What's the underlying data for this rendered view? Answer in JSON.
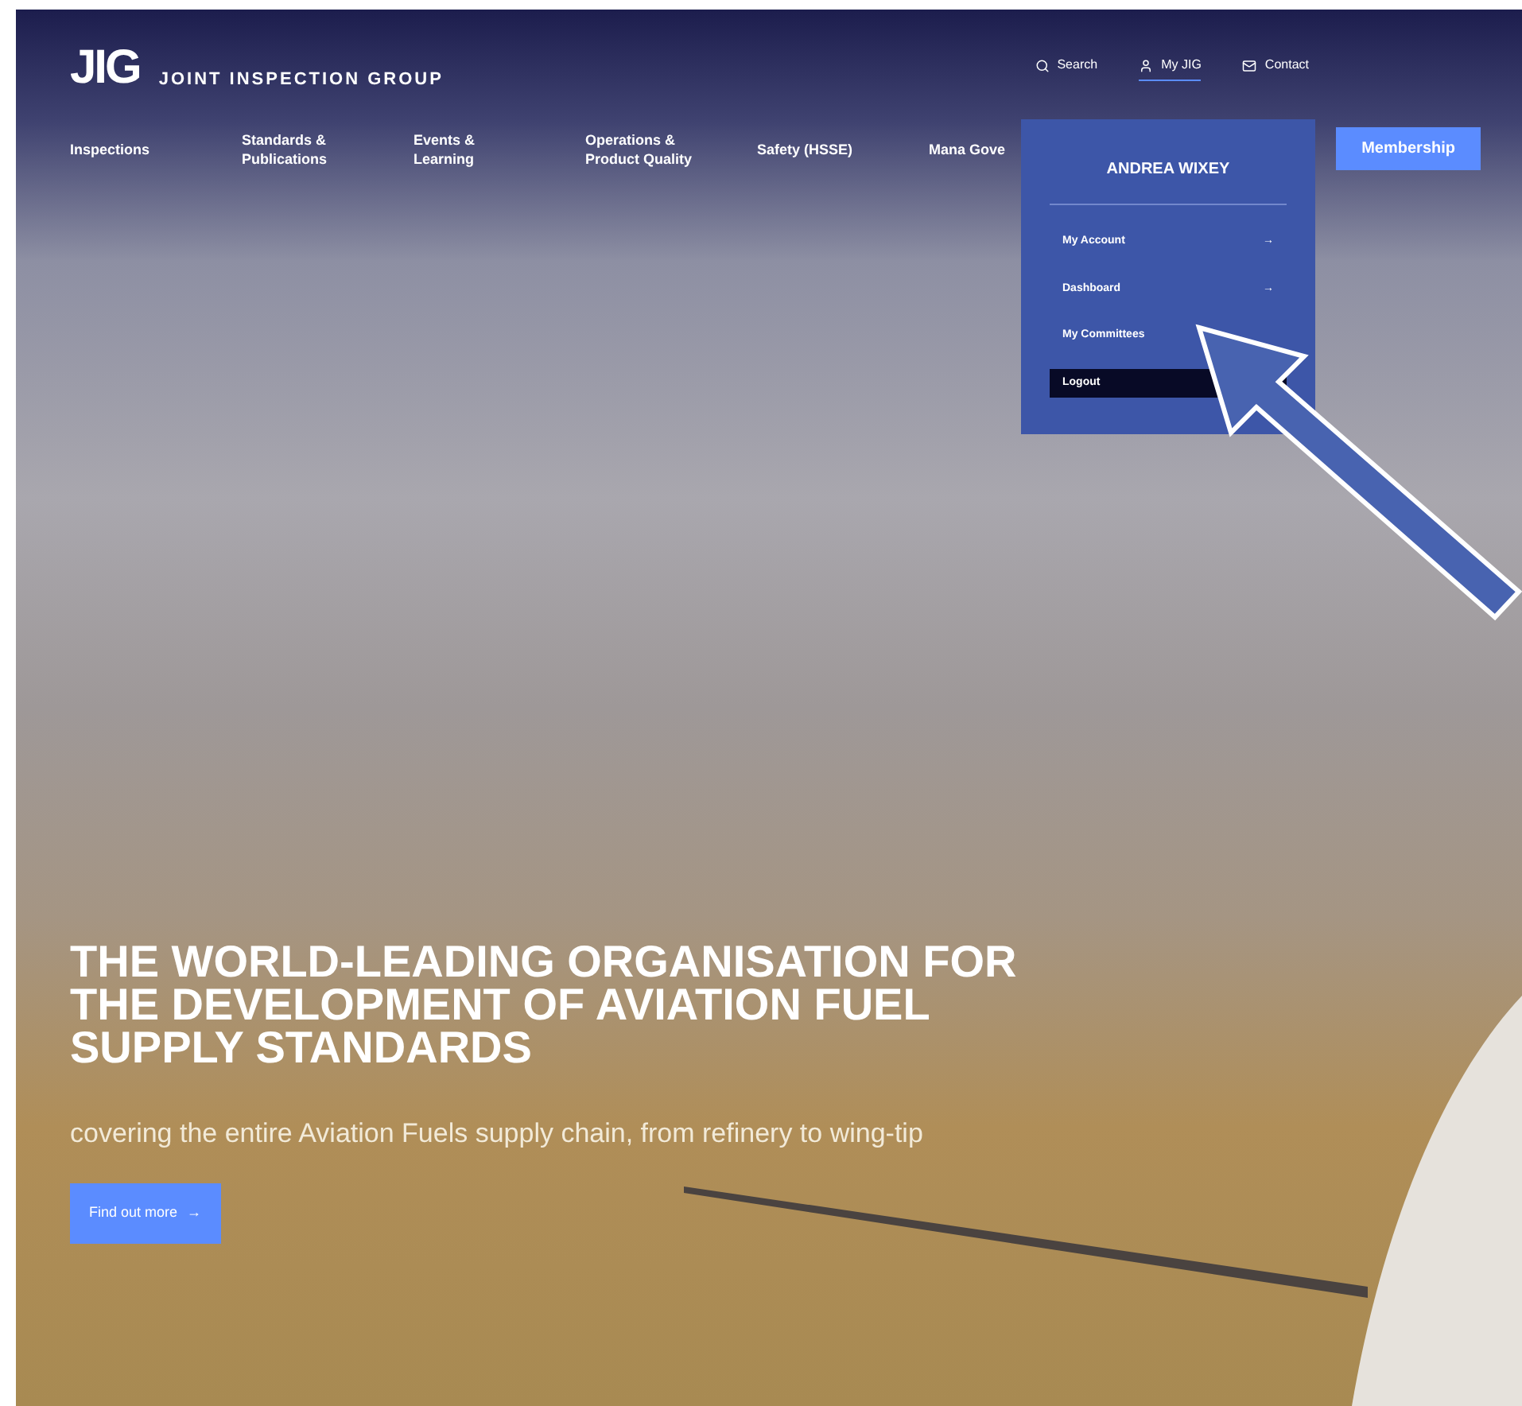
{
  "logo": {
    "mark": "JIG",
    "name": "JOINT INSPECTION GROUP"
  },
  "utility_nav": [
    {
      "label": "Search",
      "kind": "search",
      "selected": false
    },
    {
      "label": "My JIG",
      "kind": "user",
      "selected": true
    },
    {
      "label": "Contact",
      "kind": "mail",
      "selected": false
    }
  ],
  "main_nav": [
    {
      "label": "Inspections"
    },
    {
      "label": "Standards & Publications"
    },
    {
      "label": "Events & Learning"
    },
    {
      "label": "Operations & Product Quality"
    },
    {
      "label": "Safety (HSSE)"
    },
    {
      "label": "Mana Gove"
    }
  ],
  "membership_button": "Membership",
  "account_menu": {
    "user_name": "ANDREA WIXEY",
    "items": [
      {
        "label": "My Account",
        "arrow": "→",
        "selected": false
      },
      {
        "label": "Dashboard",
        "arrow": "→",
        "selected": false
      },
      {
        "label": "My Committees",
        "selected": false
      },
      {
        "label": "Logout",
        "selected": true
      }
    ]
  },
  "hero": {
    "headline": "THE WORLD-LEADING ORGANISATION FOR THE DEVELOPMENT OF AVIATION FUEL SUPPLY STANDARDS",
    "subtitle": "covering the entire Aviation Fuels supply chain, from refinery to wing-tip",
    "cta": "Find out more",
    "cta_arrow": "→"
  }
}
